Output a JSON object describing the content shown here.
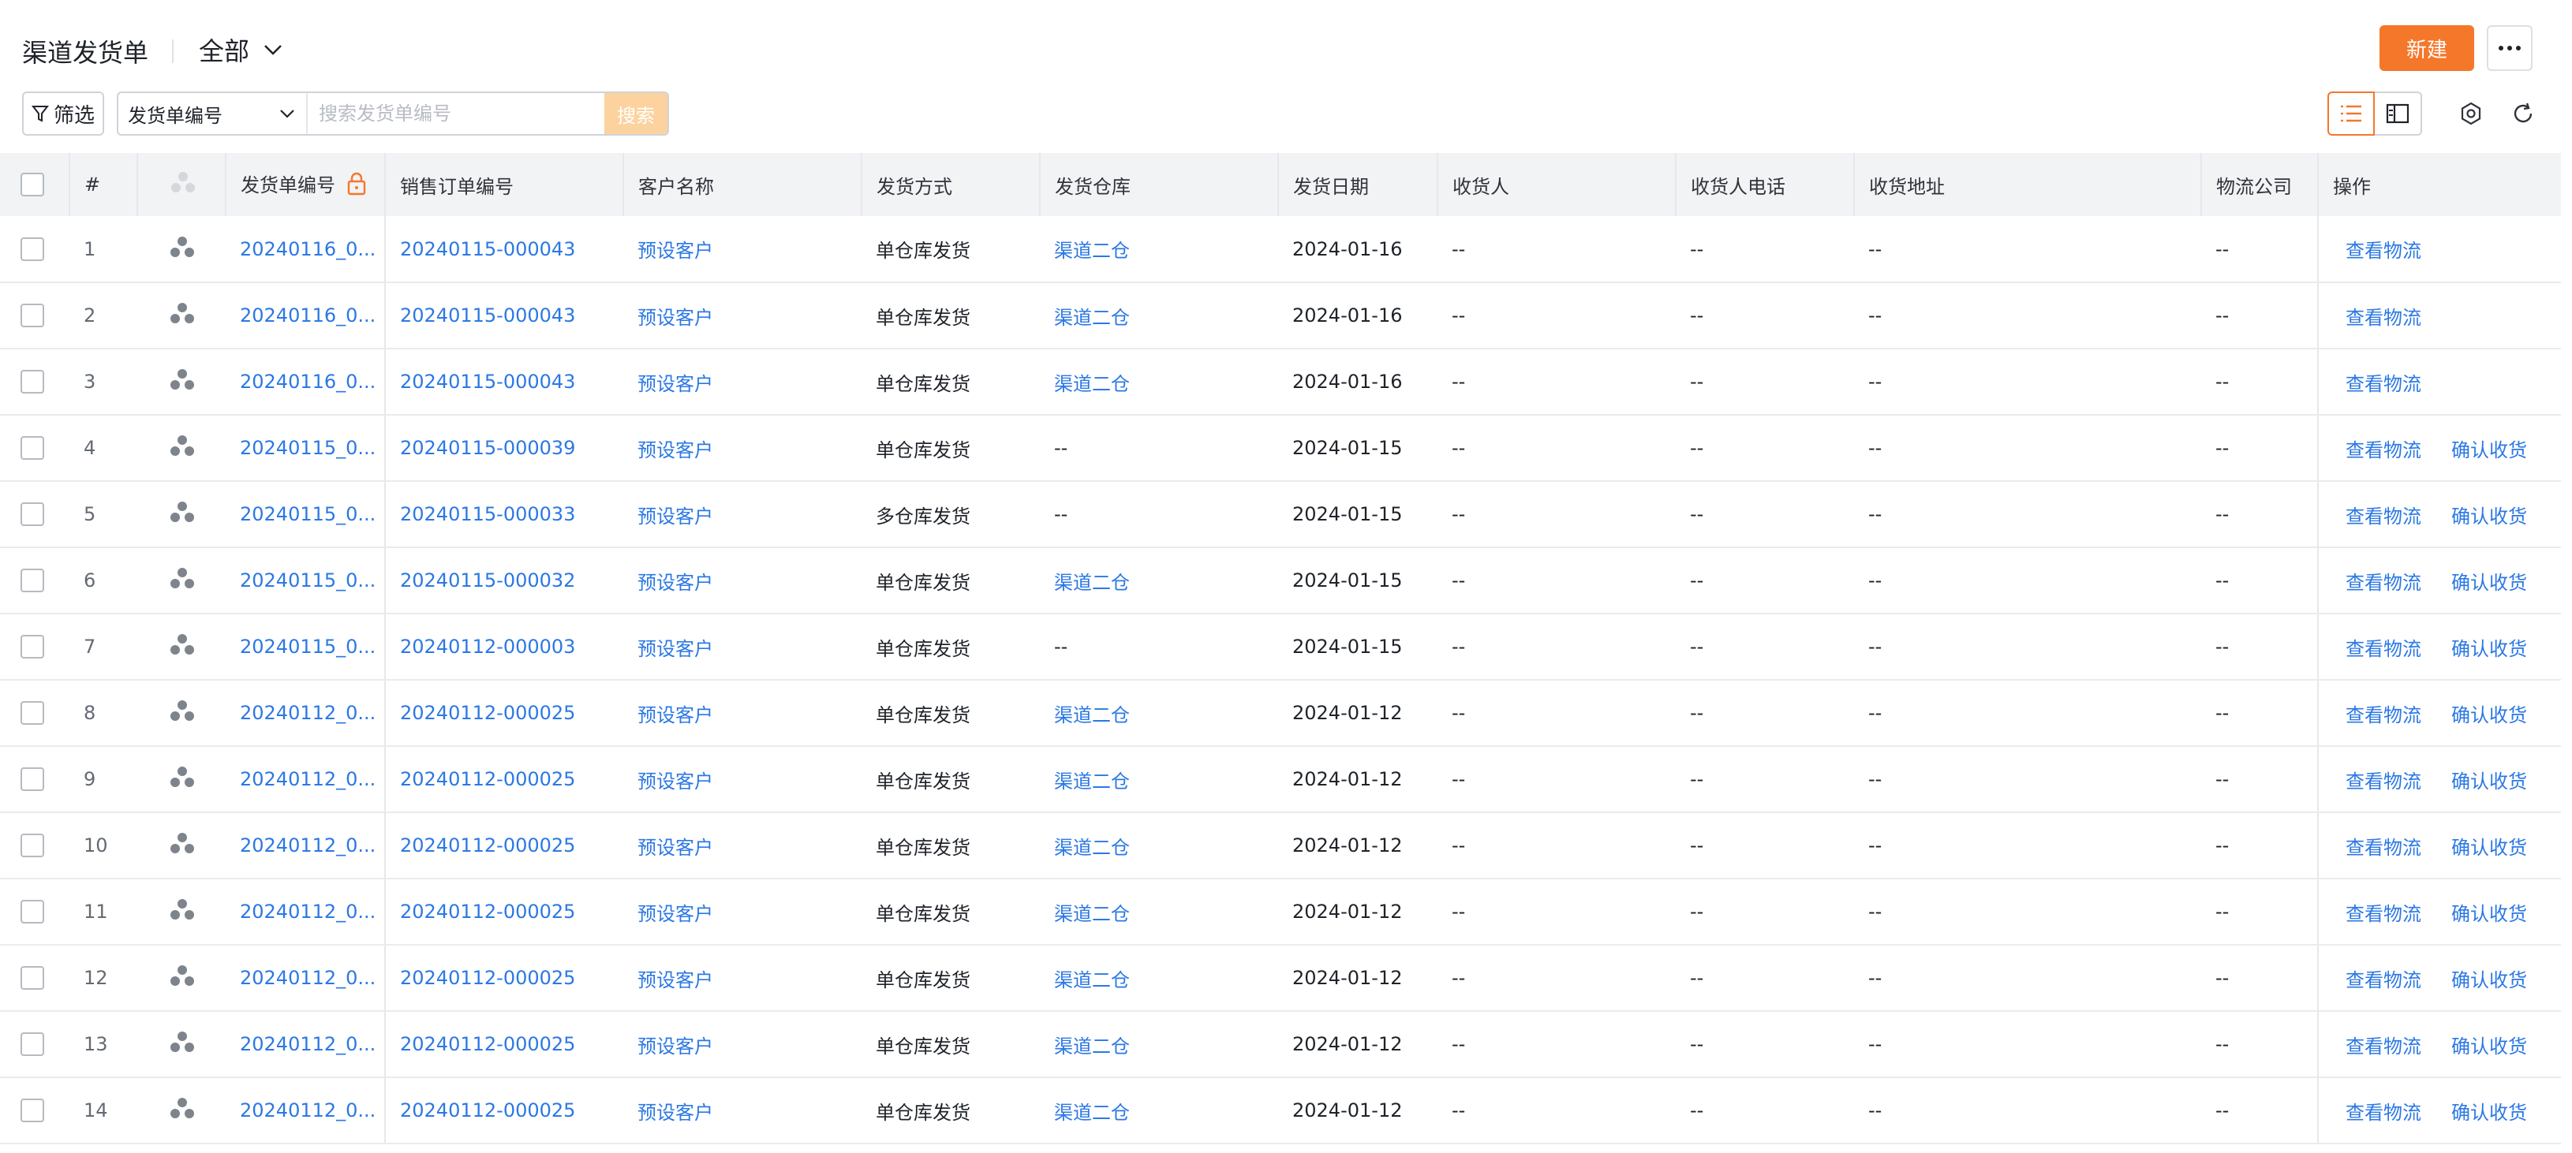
{
  "header": {
    "title": "渠道发货单",
    "view_selector": "全部",
    "new_button": "新建"
  },
  "toolbar": {
    "filter_label": "筛选",
    "search_field": "发货单编号",
    "search_placeholder": "搜索发货单编号",
    "search_button": "搜索"
  },
  "table": {
    "columns": {
      "index": "#",
      "shipment_no": "发货单编号",
      "sales_order_no": "销售订单编号",
      "customer": "客户名称",
      "ship_method": "发货方式",
      "warehouse": "发货仓库",
      "ship_date": "发货日期",
      "receiver": "收货人",
      "receiver_phone": "收货人电话",
      "address": "收货地址",
      "logistics": "物流公司",
      "actions": "操作"
    },
    "rows": [
      {
        "index": "1",
        "shipment_no": "20240116_0...",
        "sales_order_no": "20240115-000043",
        "customer": "预设客户",
        "ship_method": "单仓库发货",
        "warehouse": "渠道二仓",
        "ship_date": "2024-01-16",
        "receiver": "--",
        "receiver_phone": "--",
        "address": "--",
        "logistics": "--",
        "action1": "查看物流",
        "action2": ""
      },
      {
        "index": "2",
        "shipment_no": "20240116_0...",
        "sales_order_no": "20240115-000043",
        "customer": "预设客户",
        "ship_method": "单仓库发货",
        "warehouse": "渠道二仓",
        "ship_date": "2024-01-16",
        "receiver": "--",
        "receiver_phone": "--",
        "address": "--",
        "logistics": "--",
        "action1": "查看物流",
        "action2": ""
      },
      {
        "index": "3",
        "shipment_no": "20240116_0...",
        "sales_order_no": "20240115-000043",
        "customer": "预设客户",
        "ship_method": "单仓库发货",
        "warehouse": "渠道二仓",
        "ship_date": "2024-01-16",
        "receiver": "--",
        "receiver_phone": "--",
        "address": "--",
        "logistics": "--",
        "action1": "查看物流",
        "action2": ""
      },
      {
        "index": "4",
        "shipment_no": "20240115_0...",
        "sales_order_no": "20240115-000039",
        "customer": "预设客户",
        "ship_method": "单仓库发货",
        "warehouse": "--",
        "ship_date": "2024-01-15",
        "receiver": "--",
        "receiver_phone": "--",
        "address": "--",
        "logistics": "--",
        "action1": "查看物流",
        "action2": "确认收货"
      },
      {
        "index": "5",
        "shipment_no": "20240115_0...",
        "sales_order_no": "20240115-000033",
        "customer": "预设客户",
        "ship_method": "多仓库发货",
        "warehouse": "--",
        "ship_date": "2024-01-15",
        "receiver": "--",
        "receiver_phone": "--",
        "address": "--",
        "logistics": "--",
        "action1": "查看物流",
        "action2": "确认收货"
      },
      {
        "index": "6",
        "shipment_no": "20240115_0...",
        "sales_order_no": "20240115-000032",
        "customer": "预设客户",
        "ship_method": "单仓库发货",
        "warehouse": "渠道二仓",
        "ship_date": "2024-01-15",
        "receiver": "--",
        "receiver_phone": "--",
        "address": "--",
        "logistics": "--",
        "action1": "查看物流",
        "action2": "确认收货"
      },
      {
        "index": "7",
        "shipment_no": "20240115_0...",
        "sales_order_no": "20240112-000003",
        "customer": "预设客户",
        "ship_method": "单仓库发货",
        "warehouse": "--",
        "ship_date": "2024-01-15",
        "receiver": "--",
        "receiver_phone": "--",
        "address": "--",
        "logistics": "--",
        "action1": "查看物流",
        "action2": "确认收货"
      },
      {
        "index": "8",
        "shipment_no": "20240112_0...",
        "sales_order_no": "20240112-000025",
        "customer": "预设客户",
        "ship_method": "单仓库发货",
        "warehouse": "渠道二仓",
        "ship_date": "2024-01-12",
        "receiver": "--",
        "receiver_phone": "--",
        "address": "--",
        "logistics": "--",
        "action1": "查看物流",
        "action2": "确认收货"
      },
      {
        "index": "9",
        "shipment_no": "20240112_0...",
        "sales_order_no": "20240112-000025",
        "customer": "预设客户",
        "ship_method": "单仓库发货",
        "warehouse": "渠道二仓",
        "ship_date": "2024-01-12",
        "receiver": "--",
        "receiver_phone": "--",
        "address": "--",
        "logistics": "--",
        "action1": "查看物流",
        "action2": "确认收货"
      },
      {
        "index": "10",
        "shipment_no": "20240112_0...",
        "sales_order_no": "20240112-000025",
        "customer": "预设客户",
        "ship_method": "单仓库发货",
        "warehouse": "渠道二仓",
        "ship_date": "2024-01-12",
        "receiver": "--",
        "receiver_phone": "--",
        "address": "--",
        "logistics": "--",
        "action1": "查看物流",
        "action2": "确认收货"
      },
      {
        "index": "11",
        "shipment_no": "20240112_0...",
        "sales_order_no": "20240112-000025",
        "customer": "预设客户",
        "ship_method": "单仓库发货",
        "warehouse": "渠道二仓",
        "ship_date": "2024-01-12",
        "receiver": "--",
        "receiver_phone": "--",
        "address": "--",
        "logistics": "--",
        "action1": "查看物流",
        "action2": "确认收货"
      },
      {
        "index": "12",
        "shipment_no": "20240112_0...",
        "sales_order_no": "20240112-000025",
        "customer": "预设客户",
        "ship_method": "单仓库发货",
        "warehouse": "渠道二仓",
        "ship_date": "2024-01-12",
        "receiver": "--",
        "receiver_phone": "--",
        "address": "--",
        "logistics": "--",
        "action1": "查看物流",
        "action2": "确认收货"
      },
      {
        "index": "13",
        "shipment_no": "20240112_0...",
        "sales_order_no": "20240112-000025",
        "customer": "预设客户",
        "ship_method": "单仓库发货",
        "warehouse": "渠道二仓",
        "ship_date": "2024-01-12",
        "receiver": "--",
        "receiver_phone": "--",
        "address": "--",
        "logistics": "--",
        "action1": "查看物流",
        "action2": "确认收货"
      },
      {
        "index": "14",
        "shipment_no": "20240112_0...",
        "sales_order_no": "20240112-000025",
        "customer": "预设客户",
        "ship_method": "单仓库发货",
        "warehouse": "渠道二仓",
        "ship_date": "2024-01-12",
        "receiver": "--",
        "receiver_phone": "--",
        "address": "--",
        "logistics": "--",
        "action1": "查看物流",
        "action2": "确认收货"
      }
    ]
  },
  "colors": {
    "accent": "#f5772a",
    "link": "#2b78e4",
    "header_bg": "#f2f3f5"
  },
  "icons": [
    "chevron-down-icon",
    "more-icon",
    "filter-icon",
    "list-view-icon",
    "card-view-icon",
    "settings-icon",
    "refresh-icon",
    "lock-icon",
    "avatar-group-icon"
  ]
}
